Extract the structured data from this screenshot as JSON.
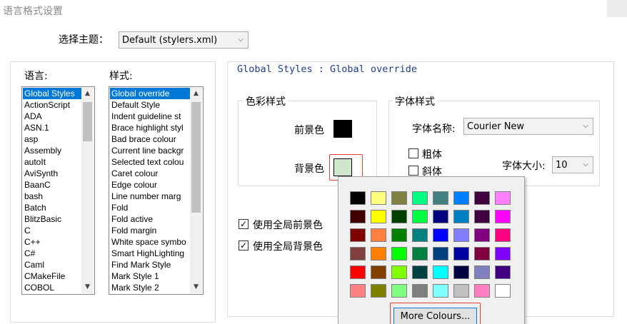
{
  "window": {
    "title": "语言格式设置"
  },
  "theme": {
    "label": "选择主题：",
    "value": "Default (stylers.xml)"
  },
  "language": {
    "label": "语言:",
    "items": [
      "Global Styles",
      "ActionScript",
      "ADA",
      "ASN.1",
      "asp",
      "Assembly",
      "autoIt",
      "AviSynth",
      "BaanC",
      "bash",
      "Batch",
      "BlitzBasic",
      "C",
      "C++",
      "C#",
      "Caml",
      "CMakeFile",
      "COBOL"
    ],
    "selected_index": 0
  },
  "style": {
    "label": "样式:",
    "items": [
      "Global override",
      "Default Style",
      "Indent guideline st",
      "Brace highlight styl",
      "Bad brace colour",
      "Current line backgr",
      "Selected text colou",
      "Caret colour",
      "Edge colour",
      "Line number marg",
      "Fold",
      "Fold active",
      "Fold margin",
      "White space symbo",
      "Smart HighLighting",
      "Find Mark Style",
      "Mark Style 1",
      "Mark Style 2"
    ],
    "selected_index": 0
  },
  "header": {
    "text": "Global Styles : Global override"
  },
  "color_style": {
    "label": "色彩样式",
    "fg_label": "前景色",
    "bg_label": "背景色",
    "fg_color": "#000000",
    "bg_color": "#cfe6cf"
  },
  "font_style": {
    "label": "字体样式",
    "name_label": "字体名称:",
    "name_value": "Courier New",
    "bold_label": "粗体",
    "italic_label": "斜体",
    "size_label": "字体大小:",
    "size_value": "10"
  },
  "global": {
    "use_fg_label": "使用全局前景色",
    "use_bg_label": "使用全局背景色",
    "use_fg_checked": true,
    "use_bg_checked": true
  },
  "palette": {
    "colors": [
      [
        "#000000",
        "#ffff80",
        "#808040",
        "#00ff80",
        "#408080",
        "#0080ff",
        "#400040",
        "#ff80ff"
      ],
      [
        "#400000",
        "#ffff00",
        "#004000",
        "#00ff40",
        "#000080",
        "#0080c0",
        "#400040",
        "#ff00ff"
      ],
      [
        "#800000",
        "#ff8040",
        "#008000",
        "#008080",
        "#0000ff",
        "#8080ff",
        "#800080",
        "#ff0080"
      ],
      [
        "#804040",
        "#ff8000",
        "#00ff00",
        "#008040",
        "#004080",
        "#0000a0",
        "#800040",
        "#8000ff"
      ],
      [
        "#ff0000",
        "#804000",
        "#80ff00",
        "#004040",
        "#00ffff",
        "#000040",
        "#8080c0",
        "#400080"
      ],
      [
        "#ff8080",
        "#808000",
        "#80ff80",
        "#808080",
        "#80ffff",
        "#c0c0c0",
        "#ff80c0",
        "#ffffff"
      ]
    ],
    "more_label": "More Colours..."
  }
}
